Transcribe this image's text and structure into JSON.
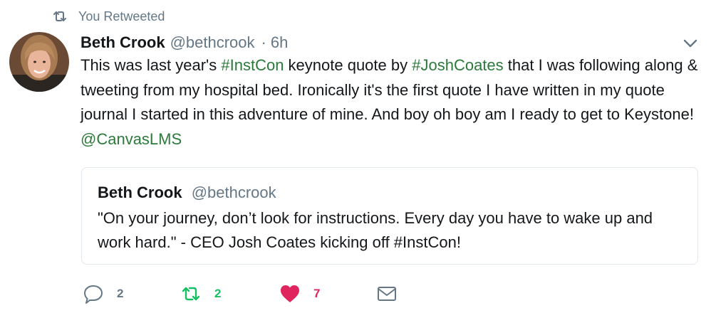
{
  "context": {
    "text": "You Retweeted"
  },
  "tweet": {
    "author_name": "Beth Crook",
    "author_handle": "@bethcrook",
    "separator": "·",
    "time": "6h",
    "text_parts": {
      "p1": "This was last year's ",
      "tag1": "#InstCon",
      "p2": " keynote quote by ",
      "tag2": "#JoshCoates",
      "p3": " that I was following along & tweeting from my hospital bed. Ironically it's the first quote I have written in my quote journal I started in this adventure of mine. And boy oh boy am I ready to get to Keystone! ",
      "mention": "@CanvasLMS"
    }
  },
  "quote": {
    "author_name": "Beth Crook",
    "author_handle": "@bethcrook",
    "text": "\"On your journey, don’t look for instructions. Every day you have to wake up and work hard.\" - CEO Josh Coates kicking off #InstCon!"
  },
  "actions": {
    "reply_count": "2",
    "retweet_count": "2",
    "like_count": "7"
  },
  "icons": {
    "retweet_context": "retweet-icon",
    "caret": "chevron-down-icon",
    "reply": "reply-icon",
    "retweet": "retweet-icon",
    "like": "heart-icon",
    "dm": "envelope-icon"
  },
  "colors": {
    "link": "#2b7a3b",
    "muted": "#657786",
    "retweet_active": "#17bf63",
    "like_active": "#e0245e",
    "border": "#e1e8ed"
  }
}
